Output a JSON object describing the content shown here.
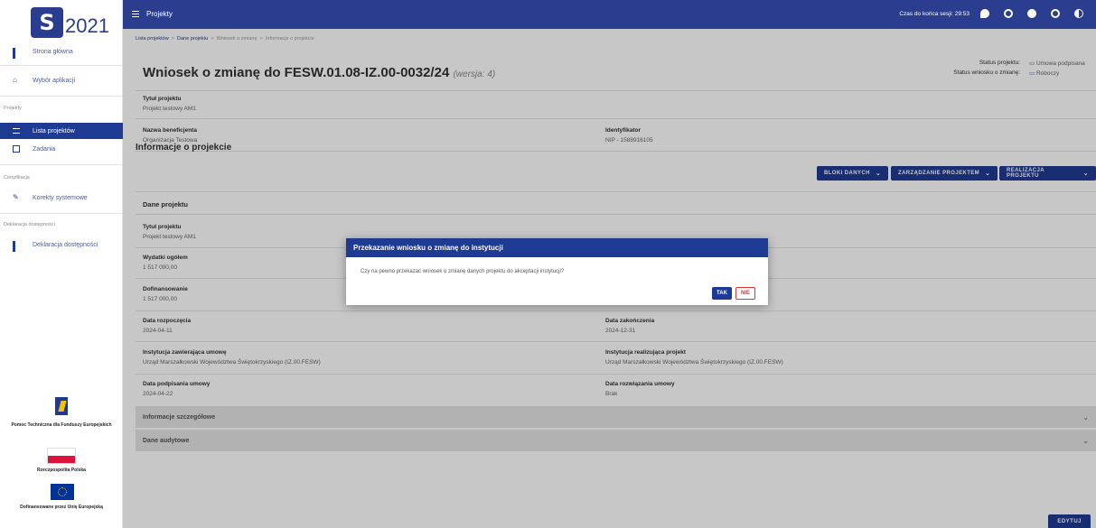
{
  "logo": {
    "year": "2021"
  },
  "sidebar": {
    "items": [
      {
        "label": "Strona główna"
      },
      {
        "label": "Wybór aplikacji"
      },
      {
        "label": "Lista projektów"
      },
      {
        "label": "Zadania"
      },
      {
        "label": "Korekty systemowe"
      },
      {
        "label": "Deklaracja dostępności"
      }
    ],
    "sections": [
      "Projekty",
      "Certyfikacja",
      "Deklaracja dostępności"
    ],
    "funders": [
      "Pomoc Techniczna dla Funduszy Europejskich",
      "Rzeczpospolita Polska",
      "Dofinansowane przez Unię Europejską"
    ]
  },
  "topbar": {
    "title": "Projekty",
    "session": "Czas do końca sesji: 29:53"
  },
  "breadcrumb": [
    "Lista projektów",
    "Dane projektu",
    "Wniosek o zmianę",
    "Informacje o projekcie"
  ],
  "page": {
    "title": "Wniosek o zmianę do FESW.01.08-IZ.00-0032/24",
    "version": "(wersja: 4)",
    "status_project_label": "Status projektu:",
    "status_project_value": "Umowa podpisana",
    "status_request_label": "Status wniosku o zmianę:",
    "status_request_value": "Roboczy"
  },
  "header_fields": {
    "title_label": "Tytuł projektu",
    "title_value": "Projekt testowy AM1",
    "beneficiary_label": "Nazwa beneficjenta",
    "beneficiary_value": "Organizacja Testowa",
    "identifier_label": "Identyfikator",
    "identifier_value": "NIP - 1588916105"
  },
  "section": {
    "title": "Informacje o projekcie",
    "btn_blocks": "BLOKI DANYCH",
    "btn_manage": "ZARZĄDZANIE PROJEKTEM",
    "btn_realize": "REALIZACJA PROJEKTU",
    "subsection": "Dane projektu"
  },
  "details": {
    "title_label": "Tytuł projektu",
    "title_value": "Projekt testowy AM1",
    "expenses_label": "Wydatki ogółem",
    "expenses_value": "1 517 000,00",
    "funding_label": "Dofinansowanie",
    "funding_value": "1 517 000,00",
    "start_label": "Data rozpoczęcia",
    "start_value": "2024-04-11",
    "end_label": "Data zakończenia",
    "end_value": "2024-12-31",
    "inst_sign_label": "Instytucja zawierająca umowę",
    "inst_sign_value": "Urząd Marszałkowski Województwa Świętokrzyskiego (IZ.00.FESW)",
    "inst_impl_label": "Instytucja realizująca projekt",
    "inst_impl_value": "Urząd Marszałkowski Województwa Świętokrzyskiego (IZ.00.FESW)",
    "signed_label": "Data podpisania umowy",
    "signed_value": "2024-04-22",
    "terminated_label": "Data rozwiązania umowy",
    "terminated_value": "Brak"
  },
  "accordions": [
    "Informacje szczegółowe",
    "Dane audytowe"
  ],
  "edit_button": "EDYTUJ",
  "modal": {
    "title": "Przekazanie wniosku o zmianę do instytucji",
    "body": "Czy na pewno przekazać wniosek o zmianę danych projektu do akceptacji instytucji?",
    "yes": "TAK",
    "no": "NIE"
  },
  "colors": {
    "primary": "#1f3a93",
    "topbar": "#2a3d8f",
    "danger": "#d33333"
  }
}
